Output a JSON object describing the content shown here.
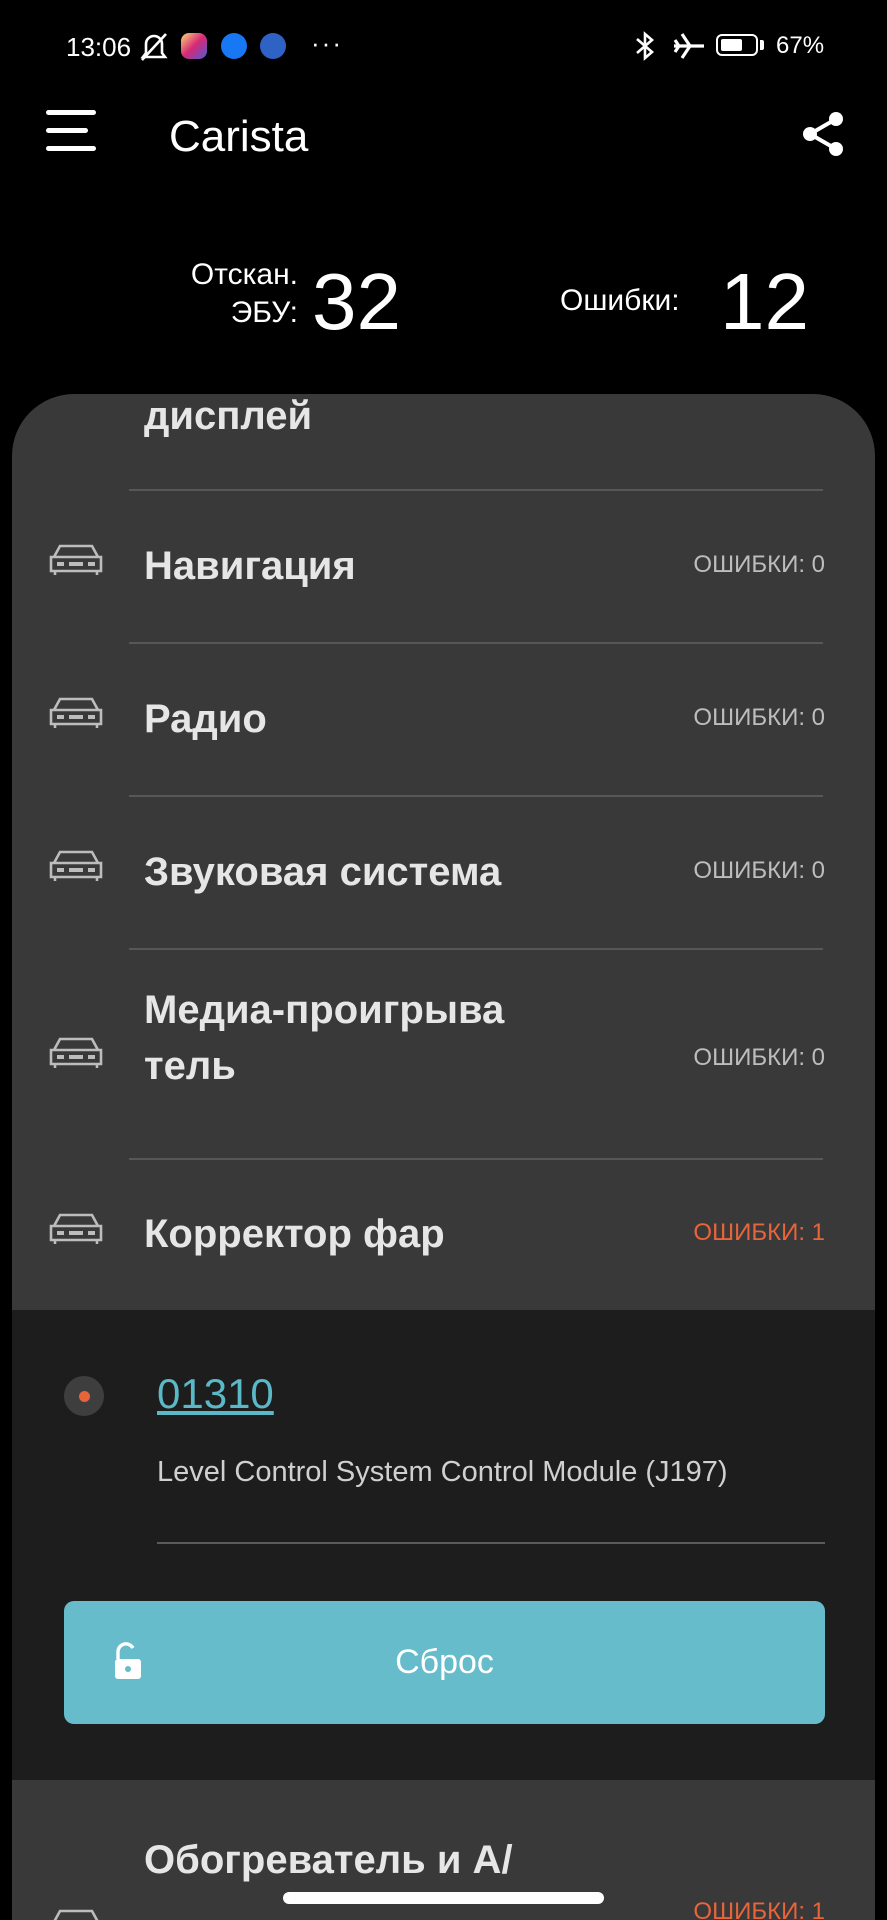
{
  "status_bar": {
    "time": "13:06",
    "dots": "···",
    "battery_percent_text": "67%",
    "battery_level": 0.67,
    "icons": [
      "mute-bell-icon",
      "instagram-icon",
      "facebook-icon",
      "app-notification-icon",
      "bluetooth-icon",
      "airplane-icon",
      "battery-icon"
    ]
  },
  "header": {
    "title": "Carista",
    "menu_icon": "hamburger-menu-icon",
    "share_icon": "share-icon"
  },
  "summary": {
    "scanned_label_line1": "Отскан.",
    "scanned_label_line2": "ЭБУ:",
    "scanned_value": "32",
    "errors_label": "Ошибки:",
    "errors_value": "12"
  },
  "list": {
    "partial_top_label": "дисплей",
    "items": [
      {
        "label": "Навигация",
        "errors": "ОШИБКИ: 0"
      },
      {
        "label": "Радио",
        "errors": "ОШИБКИ: 0"
      },
      {
        "label": "Звуковая система",
        "errors": "ОШИБКИ: 0"
      },
      {
        "label_line1": "Медиа-проигрыва",
        "label_line2": "тель",
        "errors": "ОШИБКИ: 0"
      },
      {
        "label": "Корректор фар",
        "errors": "ОШИБКИ: 1"
      }
    ],
    "expanded_error": {
      "code": "01310",
      "description": "Level Control System Control Module (J197)",
      "reset_label": "Сброс"
    },
    "partial_bottom": {
      "label": "Обогреватель и A/",
      "errors": "ОШИБКИ: 1"
    }
  },
  "colors": {
    "background": "#000000",
    "panel": "#393939",
    "expanded_block": "#1d1d1d",
    "accent": "#67bccc",
    "error_red": "#e8643a",
    "code_link": "#5ab8c7"
  }
}
